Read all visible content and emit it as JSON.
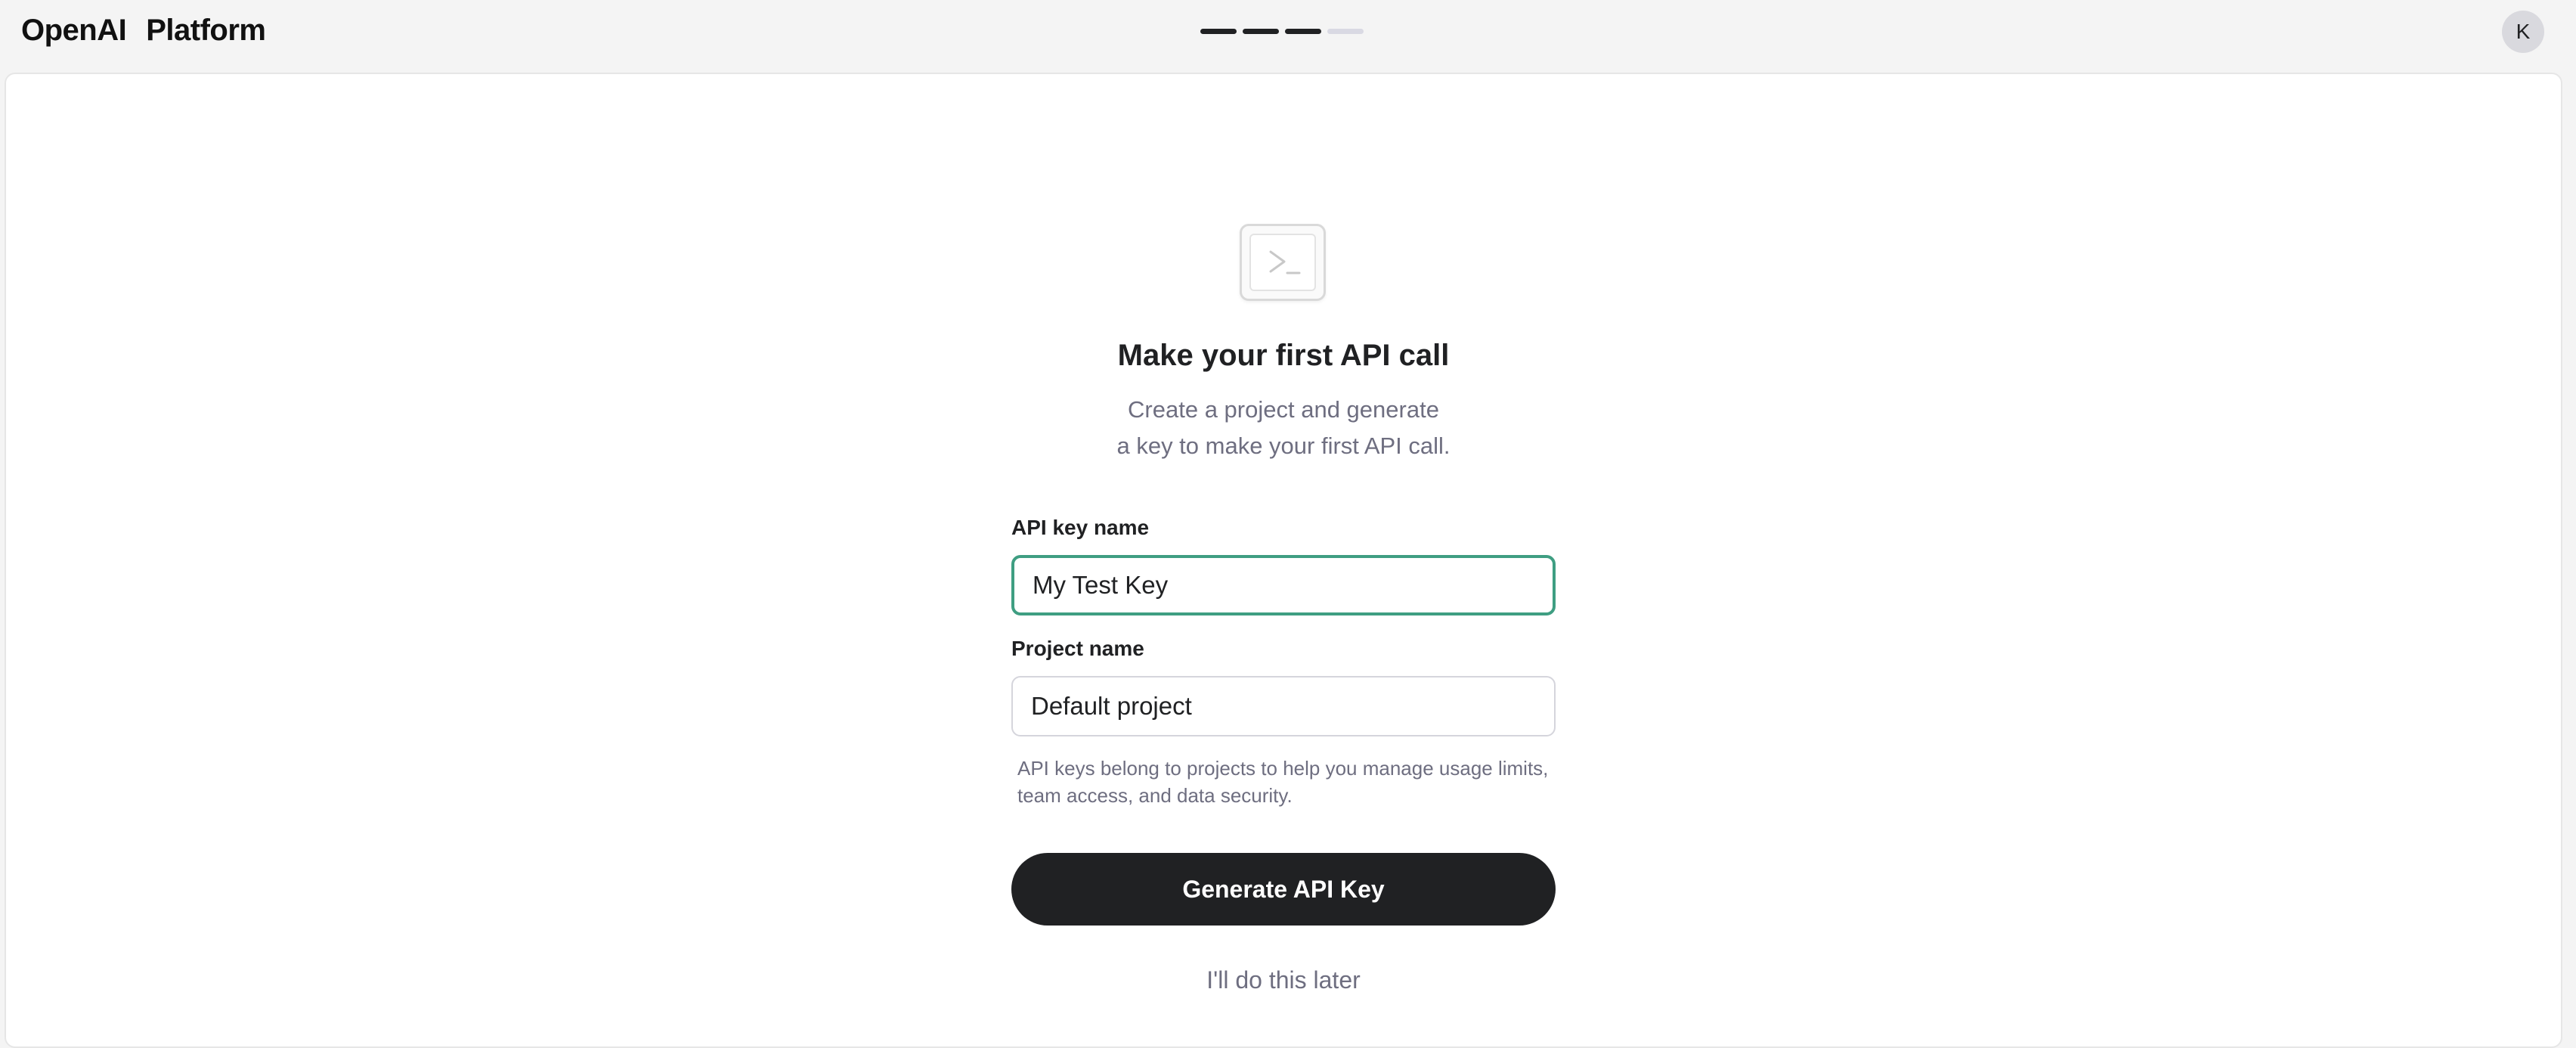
{
  "header": {
    "brand": "OpenAI",
    "product": "Platform",
    "progress": {
      "total_steps": 4,
      "completed_steps": 3
    },
    "avatar_initial": "K"
  },
  "onboarding": {
    "icon": "terminal-icon",
    "title": "Make your first API call",
    "subtitle_lines": [
      "Create a project and generate",
      "a key to make your first API call."
    ],
    "api_key_field": {
      "label": "API key name",
      "value": "My Test Key",
      "focused": true
    },
    "project_field": {
      "label": "Project name",
      "value": "Default project"
    },
    "help_lines": [
      "API keys belong to projects to help you manage usage limits,",
      "team access, and data security."
    ],
    "generate_button_label": "Generate API Key",
    "later_link_label": "I'll do this later"
  },
  "colors": {
    "focus_border": "#3f9e82",
    "primary_button": "#202123",
    "muted_text": "#6e6e80",
    "progress_done": "#202123",
    "progress_pending": "#d9d9e3"
  }
}
